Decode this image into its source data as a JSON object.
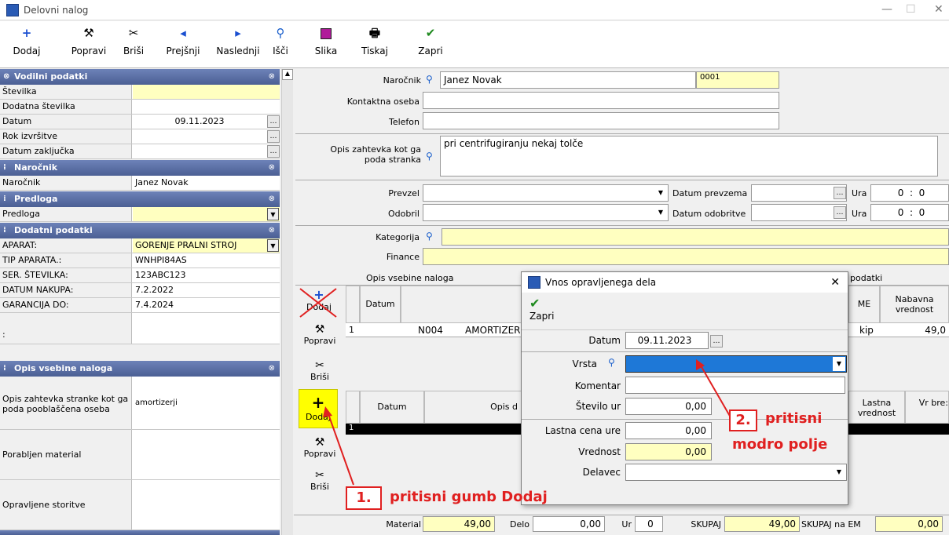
{
  "window": {
    "title": "Delovni nalog",
    "min": "—",
    "max": "☐",
    "close": "✕"
  },
  "toolbar": {
    "dodaj": "Dodaj",
    "popravi": "Popravi",
    "brisi": "Briši",
    "prejsnji": "Prejšnji",
    "naslednji": "Naslednji",
    "isci": "Išči",
    "slika": "Slika",
    "tiskaj": "Tiskaj",
    "zapri": "Zapri"
  },
  "left": {
    "s1": "Vodilni podatki",
    "stevilka": "Številka",
    "dodatna": "Dodatna številka",
    "datum": "Datum",
    "datum_val": "09.11.2023",
    "rok": "Rok izvršitve",
    "zakljucek": "Datum zaključka",
    "s2": "Naročnik",
    "narocnik": "Naročnik",
    "narocnik_val": "Janez Novak",
    "s3": "Predloga",
    "predloga": "Predloga",
    "s4": "Dodatni podatki",
    "aparat": "APARAT:",
    "aparat_val": "GORENJE PRALNI STROJ",
    "tip": "TIP APARATA.:",
    "tip_val": "WNHPI84AS",
    "ser": "SER. ŠTEVILKA:",
    "ser_val": "123ABC123",
    "nakup": "DATUM NAKUPA:",
    "nakup_val": "7.2.2022",
    "garancija": "GARANCIJA DO:",
    "garancija_val": "7.4.2024",
    "colon": ":",
    "s5": "Opis vsebine naloga",
    "opis_lbl": "Opis zahtevka stranke kot ga poda pooblaščena oseba",
    "opis_val": "amortizerji",
    "porabljen": "Porabljen material",
    "opravljene": "Opravljene storitve"
  },
  "right": {
    "narocnik_lbl": "Naročnik",
    "narocnik_val": "Janez Novak",
    "narocnik_code": "0001",
    "kontakt": "Kontaktna oseba",
    "telefon": "Telefon",
    "opis_lbl": "Opis zahtevka kot ga poda stranka",
    "opis_val": "pri centrifugiranju nekaj tolče",
    "prevzel": "Prevzel",
    "datum_prevzema": "Datum prevzema",
    "ura": "Ura",
    "odobril": "Odobril",
    "datum_odobritve": "Datum odobritve",
    "ura_h": "0",
    "ura_sep": ":",
    "ura_m": "0",
    "kategorija": "Kategorija",
    "finance": "Finance",
    "tab_opis": "Opis vsebine naloga",
    "tab_podatki": "podatki",
    "col_datum": "Datum",
    "col_me": "ME",
    "col_nab": "Nabavna vrednost",
    "row1_no": "1",
    "row1_code": "N004",
    "row1_name": "AMORTIZER",
    "row1_me": "kip",
    "row1_val": "49,0",
    "col_datum2": "Datum",
    "col_opis2": "Opis d",
    "col_lastna": "Lastna vrednost",
    "col_vr": "Vr bre:",
    "row2_no": "1",
    "material": "Material",
    "material_val": "49,00",
    "delo": "Delo",
    "delo_val": "0,00",
    "ur": "Ur",
    "ur_val": "0",
    "skupaj": "SKUPAJ",
    "skupaj_val": "49,00",
    "skupaj_em": "SKUPAJ na EM",
    "skupaj_em_val": "0,00"
  },
  "side": {
    "dodaj": "Dodaj",
    "popravi": "Popravi",
    "brisi": "Briši"
  },
  "dialog": {
    "title": "Vnos opravljenega dela",
    "zapri": "Zapri",
    "datum": "Datum",
    "datum_val": "09.11.2023",
    "vrsta": "Vrsta",
    "komentar": "Komentar",
    "stevilo": "Število ur",
    "stevilo_val": "0,00",
    "lastna": "Lastna cena ure",
    "lastna_val": "0,00",
    "vrednost": "Vrednost",
    "vrednost_val": "0,00",
    "delavec": "Delavec"
  },
  "callouts": {
    "c1_num": "1.",
    "c1_text": "pritisni gumb Dodaj",
    "c2_num": "2.",
    "c2_text1": "pritisni",
    "c2_text2": "modro polje"
  },
  "colors": {
    "header": "#4b5f94",
    "required": "#ffffc0",
    "annotation": "#e02020",
    "selection": "#1e78d7"
  }
}
